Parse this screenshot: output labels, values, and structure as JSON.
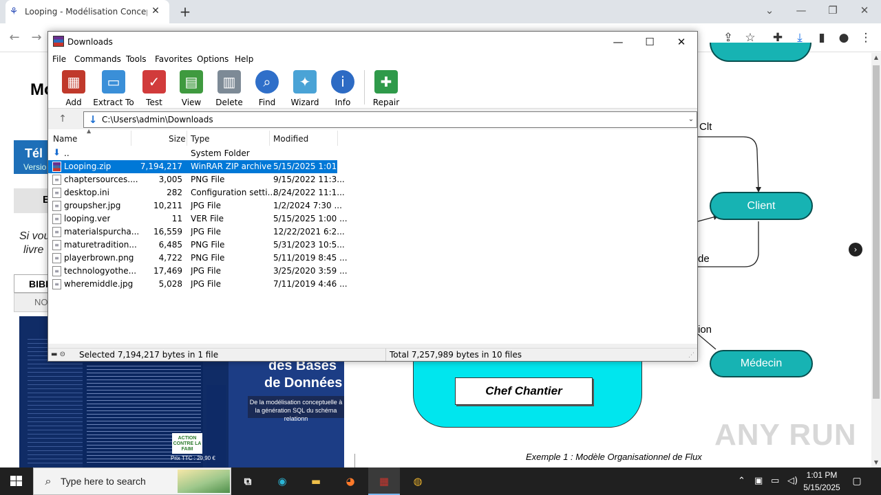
{
  "browser": {
    "tab_title": "Looping - Modélisation Concept",
    "new_tab_glyph": "+",
    "close_glyph": "✕"
  },
  "webpage": {
    "heading_fragment": "Mo",
    "tele_fragment": "Tél",
    "version_fragment": "Versio",
    "grey_letter": "E",
    "si_vous_fragment": "Si vou",
    "livre_fragment": "livre",
    "biblio_fragment": "BIBI",
    "no_fragment": "NO",
    "book_title_1": "des Bases",
    "book_title_2": "de Données",
    "book_subtitle": "De la modélisation conceptuelle à la génération SQL du schéma relationn",
    "book_action": "ACTION CONTRE LA FAIM",
    "book_price": "Prix TTC : 29,90 €",
    "diagram": {
      "label_clt": "Clt",
      "label_client": "Client",
      "label_de": "de",
      "label_ion": "ion",
      "label_medecin": "Médecin",
      "label_chef": "Chef Chantier",
      "caption": "Exemple 1 : Modèle Organisationnel de Flux"
    },
    "watermark": "ANY RUN"
  },
  "winrar": {
    "title": "Downloads",
    "menu": [
      "File",
      "Commands",
      "Tools",
      "Favorites",
      "Options",
      "Help"
    ],
    "tools": [
      {
        "label": "Add",
        "icon": "add-archive-icon",
        "color": "#c0392b"
      },
      {
        "label": "Extract To",
        "icon": "extract-folder-icon",
        "color": "#3a8fd8"
      },
      {
        "label": "Test",
        "icon": "test-checklist-icon",
        "color": "#d13b3b"
      },
      {
        "label": "View",
        "icon": "view-book-icon",
        "color": "#3f9a3f"
      },
      {
        "label": "Delete",
        "icon": "delete-trash-icon",
        "color": "#7d8a96"
      },
      {
        "label": "Find",
        "icon": "find-magnifier-icon",
        "color": "#2f6fc9"
      },
      {
        "label": "Wizard",
        "icon": "wizard-wand-icon",
        "color": "#4aa3d6"
      },
      {
        "label": "Info",
        "icon": "info-icon",
        "color": "#2d6bc4"
      },
      {
        "label": "Repair",
        "icon": "repair-kit-icon",
        "color": "#2f9a4a"
      }
    ],
    "address": "C:\\Users\\admin\\Downloads",
    "columns": {
      "name": "Name",
      "size": "Size",
      "type": "Type",
      "modified": "Modified"
    },
    "rows": [
      {
        "name": "..",
        "size": "",
        "type": "System Folder",
        "modified": "",
        "selected": false
      },
      {
        "name": "Looping.zip",
        "size": "7,194,217",
        "type": "WinRAR ZIP archive",
        "modified": "5/15/2025 1:01 ...",
        "selected": true
      },
      {
        "name": "chaptersources....",
        "size": "3,005",
        "type": "PNG File",
        "modified": "9/15/2022 11:3...",
        "selected": false
      },
      {
        "name": "desktop.ini",
        "size": "282",
        "type": "Configuration setti...",
        "modified": "8/24/2022 11:1...",
        "selected": false
      },
      {
        "name": "groupsher.jpg",
        "size": "10,211",
        "type": "JPG File",
        "modified": "1/2/2024 7:30 ...",
        "selected": false
      },
      {
        "name": "looping.ver",
        "size": "11",
        "type": "VER File",
        "modified": "5/15/2025 1:00 ...",
        "selected": false
      },
      {
        "name": "materialspurcha...",
        "size": "16,559",
        "type": "JPG File",
        "modified": "12/22/2021 6:2...",
        "selected": false
      },
      {
        "name": "maturetradition...",
        "size": "6,485",
        "type": "PNG File",
        "modified": "5/31/2023 10:5...",
        "selected": false
      },
      {
        "name": "playerbrown.png",
        "size": "4,722",
        "type": "PNG File",
        "modified": "5/11/2019 8:45 ...",
        "selected": false
      },
      {
        "name": "technologyothe...",
        "size": "17,469",
        "type": "JPG File",
        "modified": "3/25/2020 3:59 ...",
        "selected": false
      },
      {
        "name": "wheremiddle.jpg",
        "size": "5,028",
        "type": "JPG File",
        "modified": "7/11/2019 4:46 ...",
        "selected": false
      }
    ],
    "status_left": "Selected 7,194,217 bytes in 1 file",
    "status_right": "Total 7,257,989 bytes in 10 files"
  },
  "taskbar": {
    "search_placeholder": "Type here to search",
    "time": "1:01 PM",
    "date": "5/15/2025"
  }
}
